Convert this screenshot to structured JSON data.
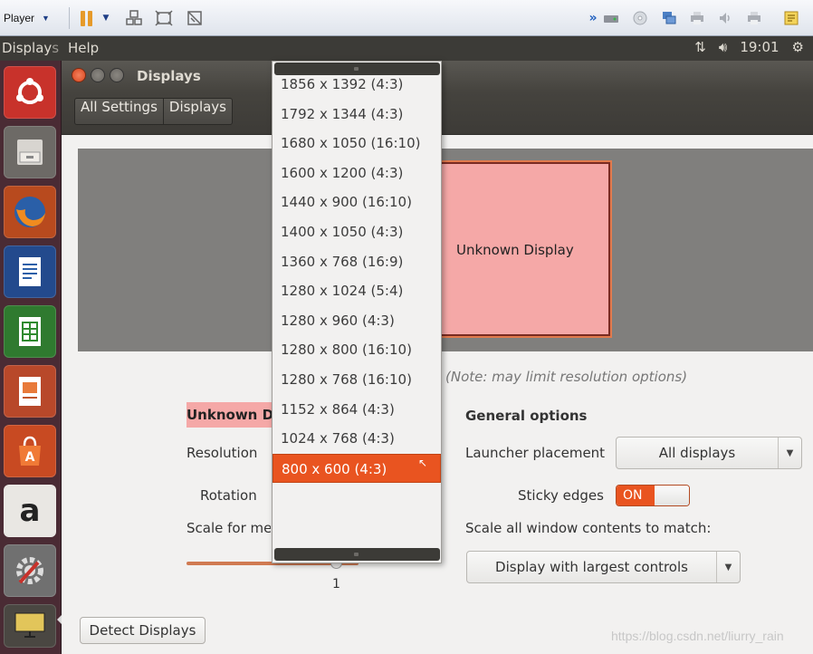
{
  "vm_toolbar": {
    "player_label": "Player",
    "icons": [
      "pause-icon",
      "send-ctrl-alt-del-icon",
      "fit-guest-icon",
      "full-screen-icon",
      "unity-icon"
    ],
    "right_icons": [
      "more-chevron-icon",
      "hdd-icon",
      "cd-icon",
      "network-icon",
      "printer-icon",
      "sound-icon",
      "usb-icon",
      "message-icon"
    ]
  },
  "top_panel": {
    "app_title": "Displays",
    "help": "Help",
    "time": "19:01"
  },
  "window": {
    "title": "Displays",
    "breadcrumb": [
      "All Settings",
      "Displays"
    ],
    "monitor_label": "Unknown Display",
    "note": "(Note: may limit resolution options)",
    "display_name": "Unknown Display",
    "resolution_label": "Resolution",
    "rotation_label": "Rotation",
    "scale_label": "Scale for menu and title bars:",
    "scale_value": "1",
    "general_options": "General options",
    "launcher_placement_label": "Launcher placement",
    "launcher_placement_value": "All displays",
    "sticky_edges_label": "Sticky edges",
    "sticky_edges_state": "ON",
    "scale_all_label": "Scale all window contents to match:",
    "scale_all_value": "Display with largest controls",
    "detect_button": "Detect Displays"
  },
  "resolution_dropdown": {
    "options": [
      "1856 x 1392 (4:3)",
      "1792 x 1344 (4:3)",
      "1680 x 1050 (16:10)",
      "1600 x 1200 (4:3)",
      "1440 x 900 (16:10)",
      "1400 x 1050 (4:3)",
      "1360 x 768 (16:9)",
      "1280 x 1024 (5:4)",
      "1280 x 960 (4:3)",
      "1280 x 800 (16:10)",
      "1280 x 768 (16:10)",
      "1152 x 864 (4:3)",
      "1024 x 768 (4:3)",
      "800 x 600 (4:3)"
    ],
    "selected": "800 x 600 (4:3)"
  },
  "watermark": "https://blog.csdn.net/liurry_rain"
}
